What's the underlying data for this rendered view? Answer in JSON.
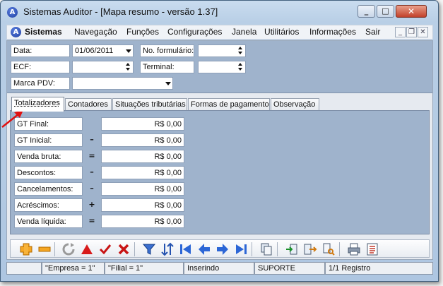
{
  "window": {
    "title": "Sistemas Auditor - [Mapa resumo - versão 1.37]",
    "app_icon": "A"
  },
  "menu": {
    "logo": "A",
    "items": [
      "Sistemas",
      "Navegação",
      "Funções",
      "Configurações",
      "Janela",
      "Utilitários",
      "Informações",
      "Sair"
    ]
  },
  "form": {
    "data_label": "Data:",
    "data_value": "01/06/2011",
    "formulario_label": "No. formulário:",
    "formulario_value": "",
    "ecf_label": "ECF:",
    "ecf_value": "",
    "terminal_label": "Terminal:",
    "terminal_value": "",
    "marca_label": "Marca PDV:",
    "marca_value": ""
  },
  "tabs": [
    "Totalizadores",
    "Contadores",
    "Situações tributárias",
    "Formas de pagamento",
    "Observação"
  ],
  "totalizadores": [
    {
      "label": "GT Final:",
      "op": "",
      "value": "R$ 0,00"
    },
    {
      "label": "GT Inicial:",
      "op": "–",
      "value": "R$ 0,00"
    },
    {
      "label": "Venda bruta:",
      "op": "=",
      "value": "R$ 0,00"
    },
    {
      "label": "Descontos:",
      "op": "–",
      "value": "R$ 0,00"
    },
    {
      "label": "Cancelamentos:",
      "op": "–",
      "value": "R$ 0,00"
    },
    {
      "label": "Acréscimos:",
      "op": "+",
      "value": "R$ 0,00"
    },
    {
      "label": "Venda líquida:",
      "op": "=",
      "value": "R$ 0,00"
    }
  ],
  "toolbar_icons": [
    "add-icon",
    "remove-icon",
    "refresh-icon",
    "warning-icon",
    "check-icon",
    "cancel-icon",
    "filter-icon",
    "sort-icon",
    "first-record-icon",
    "previous-record-icon",
    "next-record-icon",
    "last-record-icon",
    "copy-icon",
    "import-icon",
    "export-icon",
    "search-records-icon",
    "print-icon",
    "report-icon"
  ],
  "status": {
    "empresa": "\"Empresa = 1\"",
    "filial": "\"Filial = 1\"",
    "mode": "Inserindo",
    "user": "SUPORTE",
    "records": "1/1 Registro"
  },
  "colors": {
    "panel": "#9fb3cc",
    "accent_red": "#d81b1b",
    "titlebar": "#c9dcef"
  }
}
